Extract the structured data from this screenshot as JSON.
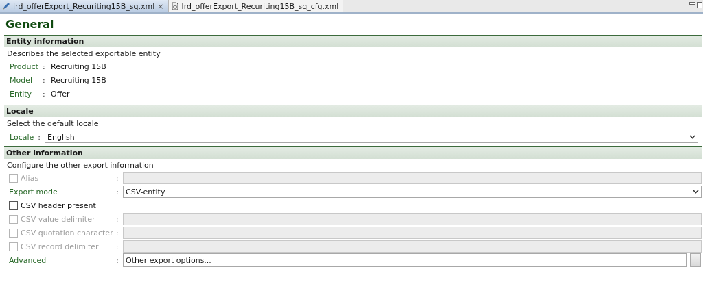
{
  "tabs": [
    {
      "label": "lrd_offerExport_Recuriting15B_sq.xml",
      "selected": true,
      "close": "×"
    },
    {
      "label": "lrd_offerExport_Recuriting15B_sq_cfg.xml",
      "selected": false
    }
  ],
  "title": "General",
  "entity_section": {
    "heading": "Entity information",
    "description": "Describes the selected exportable entity",
    "rows": [
      {
        "label": "Product",
        "sep": ":",
        "value": "Recruiting 15B"
      },
      {
        "label": "Model",
        "sep": ":",
        "value": "Recruiting 15B"
      },
      {
        "label": "Entity",
        "sep": ":",
        "value": "Offer"
      }
    ]
  },
  "locale_section": {
    "heading": "Locale",
    "description": "Select the default locale",
    "label": "Locale",
    "sep": ":",
    "value": "English"
  },
  "other_section": {
    "heading": "Other information",
    "description": "Configure the other export information",
    "rows": [
      {
        "kind": "checkfield",
        "label": "Alias",
        "sep": ":",
        "checked": false,
        "disabled": true
      },
      {
        "kind": "select",
        "label": "Export mode",
        "sep": ":",
        "value": "CSV-entity"
      },
      {
        "kind": "check",
        "label": "CSV header present",
        "checked": false,
        "disabled": false
      },
      {
        "kind": "checkfield",
        "label": "CSV value delimiter",
        "sep": ":",
        "checked": false,
        "disabled": true
      },
      {
        "kind": "checkfield",
        "label": "CSV quotation character",
        "sep": ":",
        "checked": false,
        "disabled": true
      },
      {
        "kind": "checkfield",
        "label": "CSV record delimiter",
        "sep": ":",
        "checked": false,
        "disabled": true
      },
      {
        "kind": "browse",
        "label": "Advanced",
        "sep": ":",
        "value": "Other export options...",
        "button": "..."
      }
    ]
  }
}
